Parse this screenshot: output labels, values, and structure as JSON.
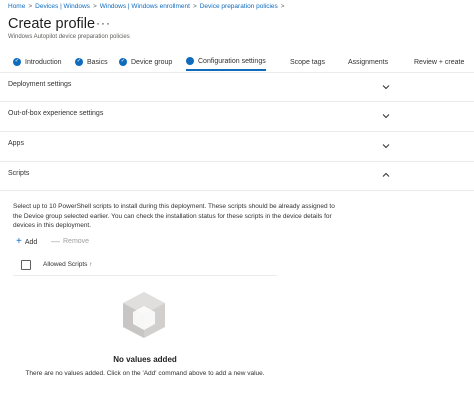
{
  "breadcrumb": [
    "Home",
    "Devices | Windows",
    "Windows | Windows enrollment",
    "Device preparation policies"
  ],
  "page": {
    "title": "Create profile",
    "more_label": "···",
    "subtitle": "Windows Autopilot device preparation policies"
  },
  "tabs": [
    {
      "label": "Introduction",
      "state": "done"
    },
    {
      "label": "Basics",
      "state": "done"
    },
    {
      "label": "Device group",
      "state": "done"
    },
    {
      "label": "Configuration settings",
      "state": "current"
    },
    {
      "label": "Scope tags",
      "state": "pending"
    },
    {
      "label": "Assignments",
      "state": "pending"
    },
    {
      "label": "Review + create",
      "state": "pending"
    }
  ],
  "sections": [
    {
      "label": "Deployment settings",
      "expanded": false
    },
    {
      "label": "Out-of-box experience settings",
      "expanded": false
    },
    {
      "label": "Apps",
      "expanded": false
    },
    {
      "label": "Scripts",
      "expanded": true
    }
  ],
  "scripts": {
    "description": "Select up to 10 PowerShell scripts to install during this deployment. These scripts should be already assigned to the Device group selected earlier. You can check the installation status for these scripts in the device details for devices in this deployment.",
    "add_label": "Add",
    "remove_label": "Remove",
    "column_header": "Allowed Scripts ↑",
    "empty_title": "No values added",
    "empty_text": "There are no values added. Click on the 'Add' command above to add a new value."
  },
  "colors": {
    "accent": "#0f6cbd",
    "divider": "#edebe9",
    "disabled": "#a19f9d"
  }
}
